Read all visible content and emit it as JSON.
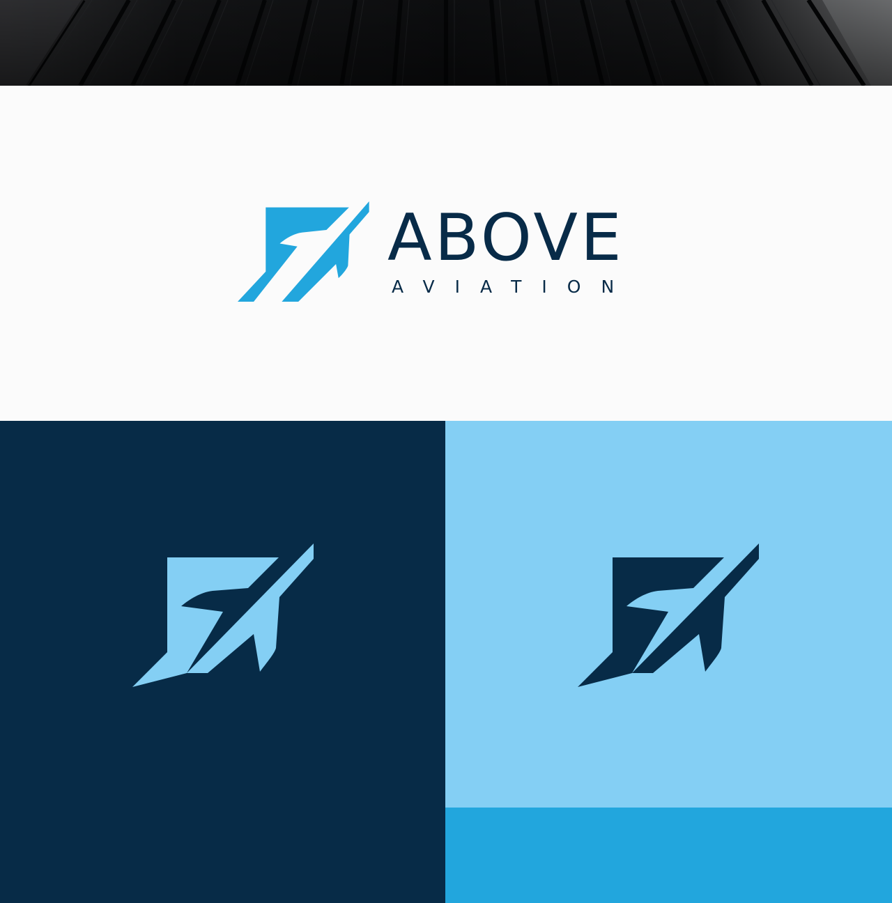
{
  "brand": {
    "name": "ABOVE",
    "tagline": "AVIATION"
  },
  "colors": {
    "navy": "#072b47",
    "sky_blue": "#22a6dd",
    "light_blue": "#84cff4",
    "off_white": "#fbfbfb"
  },
  "icons": {
    "logo_mark": "plane-flag-icon"
  }
}
